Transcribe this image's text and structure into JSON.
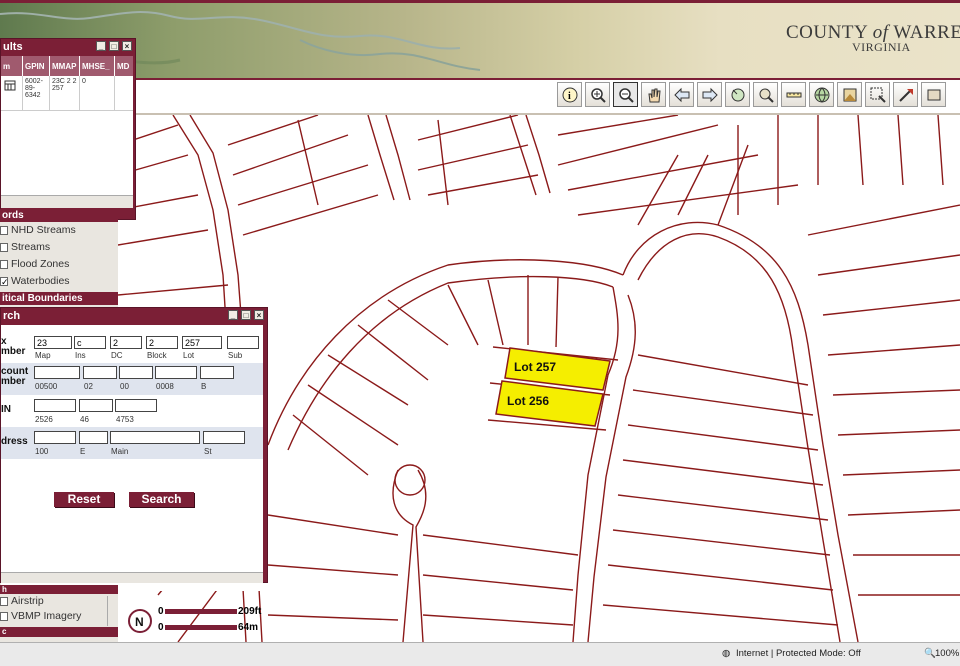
{
  "header": {
    "county_title_a": "COUNTY",
    "county_title_of": "of",
    "county_title_b": "WARRE",
    "county_sub": "VIRGINIA"
  },
  "toolbar": {
    "tools": [
      "info-icon",
      "zoom-in-icon",
      "zoom-out-icon",
      "pan-hand-icon",
      "back-icon",
      "forward-icon",
      "full-extent-icon",
      "zoom-to-layer-icon",
      "measure-icon",
      "identify-globe-icon",
      "overview-icon",
      "select-box-icon",
      "clear-selection-icon",
      "extra-icon"
    ]
  },
  "results_panel": {
    "title": "ults",
    "columns": [
      "m",
      "GPIN",
      "MMAP",
      "MHSE_",
      "MD"
    ],
    "row": {
      "gpin": "6002-89-6342",
      "mmap": "23C 2 2 257",
      "mhse": "0"
    }
  },
  "layers": {
    "section_header": "ords",
    "items": [
      {
        "label": "NHD Streams",
        "checked": false
      },
      {
        "label": "Streams",
        "checked": false
      },
      {
        "label": "Flood Zones",
        "checked": false
      },
      {
        "label": "Waterbodies",
        "checked": true
      }
    ],
    "section_header_2": "itical Boundaries",
    "bottom_header": "h",
    "bottom_items": [
      {
        "label": "Airstrip",
        "checked": false
      },
      {
        "label": "VBMP Imagery",
        "checked": false
      }
    ],
    "bottom_header_2": "c"
  },
  "search_panel": {
    "title": "rch",
    "tax_label": "x\nmber",
    "tax_values": [
      "23",
      "c",
      "2",
      "2",
      "257",
      ""
    ],
    "tax_captions": [
      "Map",
      "Ins",
      "DC",
      "Block",
      "Lot",
      "Sub"
    ],
    "account_label": "count\nmber",
    "account_captions": [
      "00500",
      "02",
      "00",
      "0008",
      "B"
    ],
    "gpin_label": "IN",
    "gpin_captions": [
      "2526",
      "46",
      "4753"
    ],
    "address_label": "dress",
    "address_captions": [
      "100",
      "E",
      "Main",
      "St"
    ],
    "reset_label": "Reset",
    "search_label": "Search"
  },
  "map": {
    "lot_a": "Lot 257",
    "lot_b": "Lot 256",
    "highlight_color": "#f5ee00",
    "road_color": "#8b1a1a"
  },
  "scale": {
    "feet_zero": "0",
    "feet_label": "209ft",
    "meters_zero": "0",
    "meters_label": "64m"
  },
  "status": {
    "zone": "Internet | Protected Mode: Off",
    "zoom": "100%"
  },
  "colors": {
    "accent": "#7b1f36",
    "panel_bg": "#e9e6e0"
  }
}
